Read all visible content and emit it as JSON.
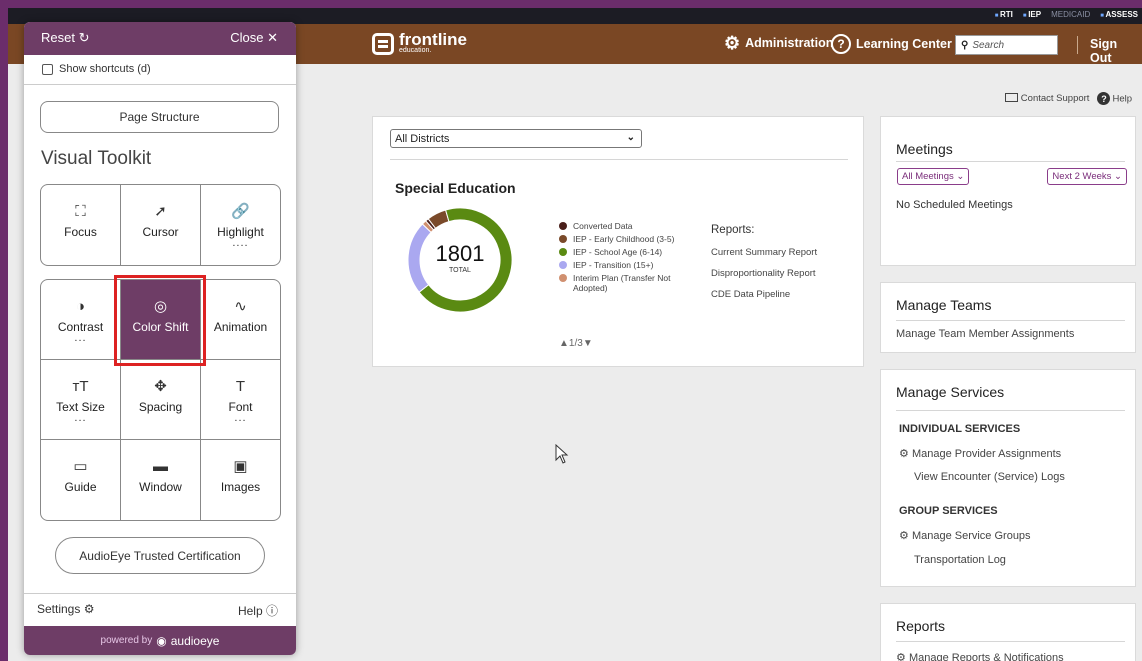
{
  "topbar": {
    "badges": [
      "RTI",
      "IEP",
      "MEDICAID",
      "ASSESS"
    ]
  },
  "navbar": {
    "logo_brand": "frontline",
    "logo_sub": "education.",
    "administration": "Administration",
    "learning_center": "Learning Center",
    "search_placeholder": "Search",
    "sign_out": "Sign Out"
  },
  "helpbar": {
    "contact": "Contact Support",
    "help": "Help"
  },
  "special_ed": {
    "district_select": "All Districts",
    "title": "Special Education",
    "total_value": "1801",
    "total_label": "TOTAL",
    "legend": [
      {
        "label": "Converted Data",
        "color": "#4a1f1a"
      },
      {
        "label": "IEP - Early Childhood (3-5)",
        "color": "#7a4a2a"
      },
      {
        "label": "IEP - School Age (6-14)",
        "color": "#5a8a12"
      },
      {
        "label": "IEP - Transition (15+)",
        "color": "#aaa8f0"
      },
      {
        "label": "Interim Plan (Transfer Not Adopted)",
        "color": "#d09070"
      }
    ],
    "pager": "1/3",
    "reports_heading": "Reports:",
    "report_links": [
      "Current Summary Report",
      "Disproportionality Report",
      "CDE Data Pipeline"
    ]
  },
  "chart_data": {
    "type": "pie",
    "title": "Special Education",
    "center_label": "1801 TOTAL",
    "categories": [
      "Converted Data",
      "IEP - Early Childhood (3-5)",
      "IEP - School Age (6-14)",
      "IEP - Transition (15+)",
      "Interim Plan (Transfer Not Adopted)"
    ],
    "values": [
      18,
      108,
      1240,
      410,
      25
    ],
    "total": 1801,
    "colors": [
      "#4a1f1a",
      "#7a4a2a",
      "#5a8a12",
      "#aaa8f0",
      "#d09070"
    ]
  },
  "meetings": {
    "title": "Meetings",
    "filter": "All Meetings",
    "range": "Next 2 Weeks",
    "empty": "No Scheduled Meetings"
  },
  "teams": {
    "title": "Manage Teams",
    "link": "Manage Team Member Assignments"
  },
  "services": {
    "title": "Manage Services",
    "individual_heading": "INDIVIDUAL SERVICES",
    "individual_links": [
      "Manage Provider Assignments",
      "View Encounter (Service) Logs"
    ],
    "group_heading": "GROUP SERVICES",
    "group_links": [
      "Manage Service Groups",
      "Transportation Log"
    ]
  },
  "reports_card": {
    "title": "Reports",
    "link": "Manage Reports & Notifications"
  },
  "toolkit": {
    "reset": "Reset",
    "close": "Close",
    "shortcuts": "Show shortcuts (d)",
    "page_structure": "Page Structure",
    "title": "Visual Toolkit",
    "tiles_a": [
      {
        "label": "Focus",
        "icon": "focus-icon"
      },
      {
        "label": "Cursor",
        "icon": "cursor-icon"
      },
      {
        "label": "Highlight",
        "icon": "link-icon",
        "more": "...."
      }
    ],
    "tiles_b": [
      {
        "label": "Contrast",
        "icon": "contrast-icon",
        "more": "..."
      },
      {
        "label": "Color Shift",
        "icon": "color-shift-icon",
        "active": true
      },
      {
        "label": "Animation",
        "icon": "animation-icon"
      },
      {
        "label": "Text Size",
        "icon": "text-size-icon",
        "more": "..."
      },
      {
        "label": "Spacing",
        "icon": "spacing-icon"
      },
      {
        "label": "Font",
        "icon": "font-icon",
        "more": "..."
      },
      {
        "label": "Guide",
        "icon": "guide-icon"
      },
      {
        "label": "Window",
        "icon": "window-icon"
      },
      {
        "label": "Images",
        "icon": "images-icon"
      }
    ],
    "certification": "AudioEye Trusted Certification",
    "settings": "Settings",
    "help": "Help",
    "powered_by": "powered by",
    "powered_brand": "audioeye"
  }
}
